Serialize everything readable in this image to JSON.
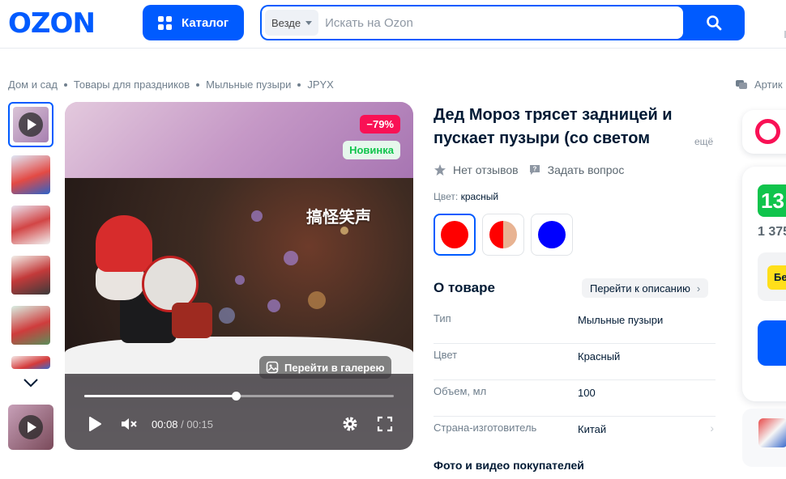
{
  "header": {
    "logo": "OZON",
    "catalog_label": "Каталог",
    "search_scope": "Везде",
    "search_placeholder": "Искать на Ozon"
  },
  "breadcrumb": [
    "Дом и сад",
    "Товары для праздников",
    "Мыльные пузыри",
    "JPYX"
  ],
  "brand_link": "Артик",
  "media": {
    "badge_discount": "−79%",
    "badge_new": "Новинка",
    "overlay_text": "搞怪笑声",
    "gallery_button": "Перейти в галерею",
    "time_current": "00:08",
    "time_sep": " / ",
    "time_total": "00:15",
    "progress": 0.49
  },
  "product": {
    "title": "Дед Мороз трясет задницей и пускает пузыри (со светом",
    "title_more": "ещё",
    "reviews": "Нет отзывов",
    "ask": "Задать вопрос",
    "color_label": "Цвет:",
    "color_value": "красный",
    "swatches": [
      "#ff0000",
      "#e8b392",
      "#0000ff"
    ]
  },
  "about": {
    "title": "О товаре",
    "link": "Перейти к описанию",
    "specs": [
      {
        "key": "Тип",
        "value": "Мыльные пузыри"
      },
      {
        "key": "Цвет",
        "value": "Красный"
      },
      {
        "key": "Объем, мл",
        "value": "100"
      },
      {
        "key": "Страна-изготовитель",
        "value": "Китай"
      }
    ],
    "photos_title": "Фото и видео покупателей"
  },
  "side": {
    "price_badge": "13",
    "price_sub": "1 375",
    "pay_chip": "Бе"
  },
  "colors": {
    "brand": "#005bff",
    "discount": "#f91155",
    "green": "#10c44c"
  }
}
